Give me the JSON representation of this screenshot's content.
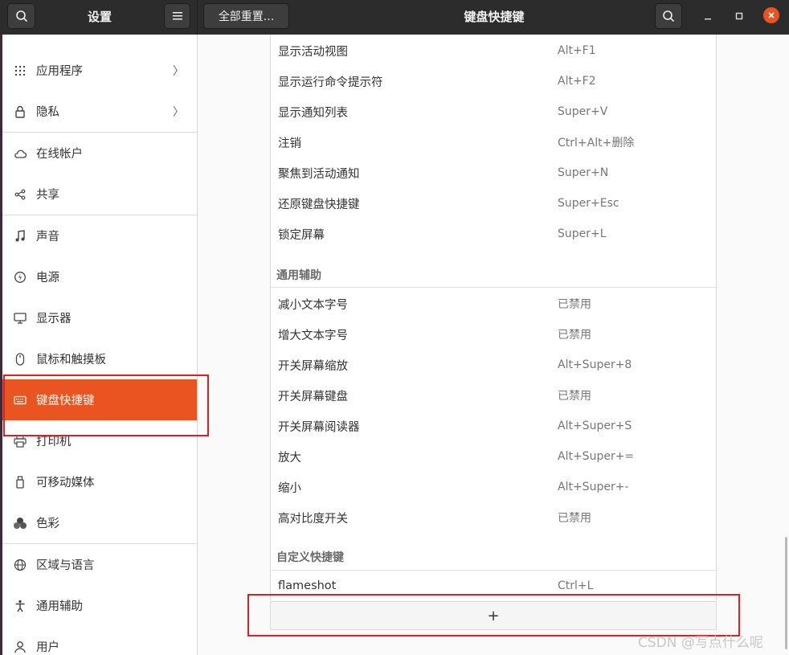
{
  "headerbar": {
    "settings_title": "设置",
    "reset_label": "全部重置...",
    "page_title": "键盘快捷键"
  },
  "sidebar": {
    "items": [
      {
        "label": "应用程序",
        "icon": "apps-grid-icon",
        "chevron": "〉"
      },
      {
        "label": "隐私",
        "icon": "lock-icon",
        "chevron": "〉"
      },
      {
        "label": "在线帐户",
        "icon": "cloud-icon"
      },
      {
        "label": "共享",
        "icon": "share-icon"
      },
      {
        "label": "声音",
        "icon": "music-note-icon"
      },
      {
        "label": "电源",
        "icon": "power-icon"
      },
      {
        "label": "显示器",
        "icon": "display-icon"
      },
      {
        "label": "鼠标和触摸板",
        "icon": "mouse-icon"
      },
      {
        "label": "键盘快捷键",
        "icon": "keyboard-icon",
        "active": true
      },
      {
        "label": "打印机",
        "icon": "printer-icon"
      },
      {
        "label": "可移动媒体",
        "icon": "usb-icon"
      },
      {
        "label": "色彩",
        "icon": "color-icon"
      },
      {
        "label": "区域与语言",
        "icon": "globe-icon"
      },
      {
        "label": "通用辅助",
        "icon": "accessibility-icon"
      },
      {
        "label": "用户",
        "icon": "user-icon"
      }
    ]
  },
  "shortcuts": {
    "system": [
      {
        "name": "显示活动视图",
        "key": "Alt+F1"
      },
      {
        "name": "显示运行命令提示符",
        "key": "Alt+F2"
      },
      {
        "name": "显示通知列表",
        "key": "Super+V"
      },
      {
        "name": "注销",
        "key": "Ctrl+Alt+删除"
      },
      {
        "name": "聚焦到活动通知",
        "key": "Super+N"
      },
      {
        "name": "还原键盘快捷键",
        "key": "Super+Esc"
      },
      {
        "name": "锁定屏幕",
        "key": "Super+L"
      }
    ],
    "accessibility_title": "通用辅助",
    "accessibility": [
      {
        "name": "减小文本字号",
        "key": "已禁用"
      },
      {
        "name": "增大文本字号",
        "key": "已禁用"
      },
      {
        "name": "开关屏幕缩放",
        "key": "Alt+Super+8"
      },
      {
        "name": "开关屏幕键盘",
        "key": "已禁用"
      },
      {
        "name": "开关屏幕阅读器",
        "key": "Alt+Super+S"
      },
      {
        "name": "放大",
        "key": "Alt+Super+="
      },
      {
        "name": "缩小",
        "key": "Alt+Super+-"
      },
      {
        "name": "高对比度开关",
        "key": "已禁用"
      }
    ],
    "custom_title": "自定义快捷键",
    "custom": [
      {
        "name": "flameshot",
        "key": "Ctrl+L"
      }
    ],
    "add_label": "+"
  },
  "watermark": "CSDN @写点什么呢",
  "colors": {
    "accent": "#e95420",
    "header_bg": "#2c2c2c",
    "annotation": "#e02020"
  }
}
